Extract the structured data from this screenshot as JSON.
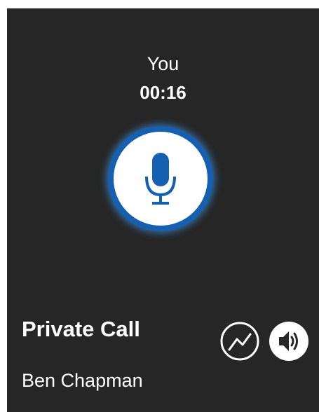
{
  "call": {
    "party_label": "You",
    "timer": "00:16",
    "type": "Private Call",
    "contact_name": "Ben Chapman"
  },
  "icons": {
    "ptt": "microphone-icon",
    "stats": "signal-graph-icon",
    "speaker": "speaker-icon"
  },
  "colors": {
    "background": "#262626",
    "accent": "#1560b0",
    "glow": "#40a0ff",
    "icon": "#1560b0"
  }
}
